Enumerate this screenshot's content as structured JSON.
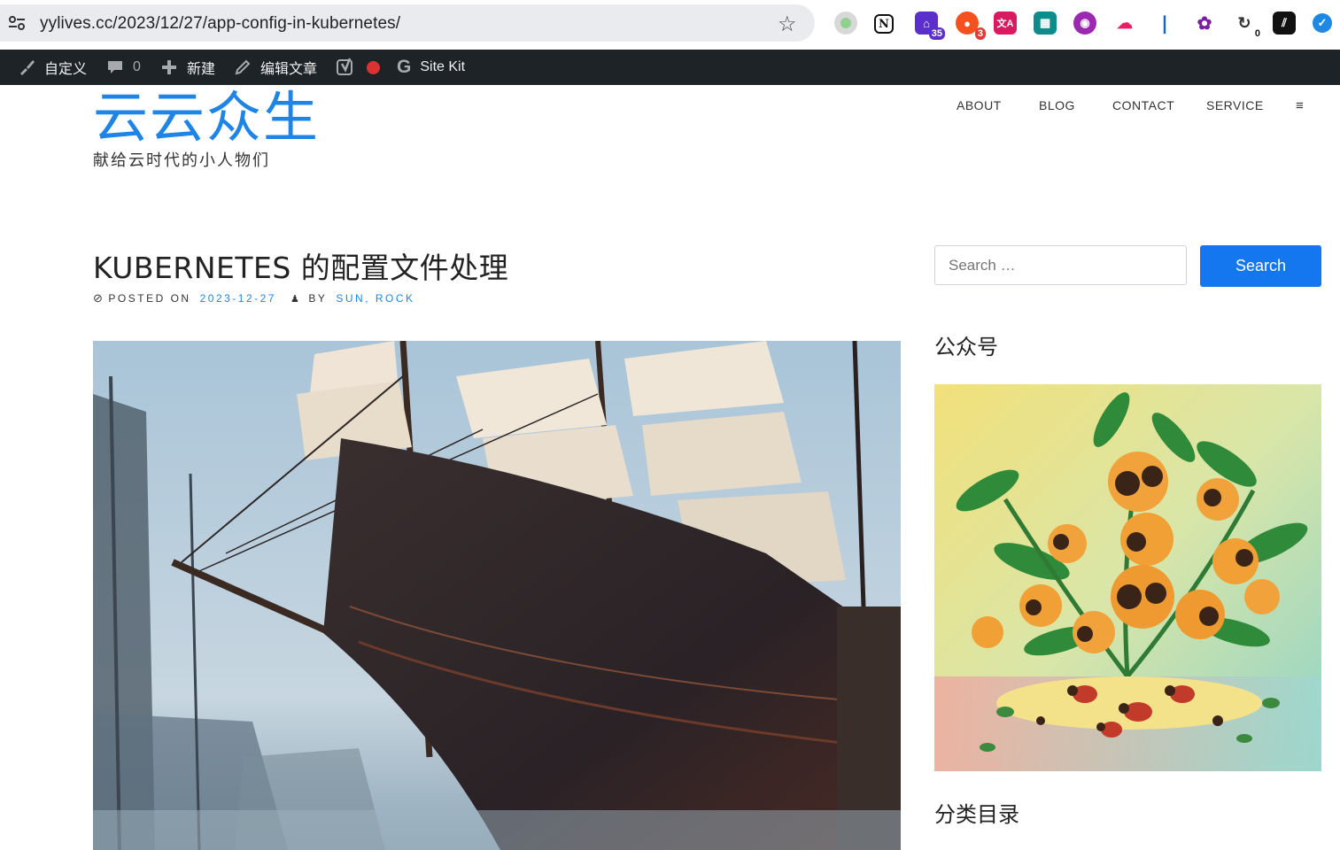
{
  "browser": {
    "url": "yylives.cc/2023/12/27/app-config-in-kubernetes/",
    "extensions": [
      {
        "name": "extension-gray-dot-icon",
        "badge": ""
      },
      {
        "name": "notion-icon",
        "badge": ""
      },
      {
        "name": "extension-house-icon",
        "badge": "35"
      },
      {
        "name": "extension-red-icon",
        "badge": "3"
      },
      {
        "name": "translate-icon",
        "badge": ""
      },
      {
        "name": "extension-grid-icon",
        "badge": ""
      },
      {
        "name": "extension-purple-icon",
        "badge": ""
      },
      {
        "name": "extension-cloud-icon",
        "badge": ""
      },
      {
        "name": "extension-blue-shape-icon",
        "badge": ""
      },
      {
        "name": "openai-icon",
        "badge": ""
      },
      {
        "name": "extension-refresh-icon",
        "badge": "0"
      },
      {
        "name": "extension-dark-icon",
        "badge": ""
      },
      {
        "name": "extension-blue-circle-icon",
        "badge": ""
      }
    ]
  },
  "adminbar": {
    "customize": "自定义",
    "comments_count": "0",
    "new": "新建",
    "edit": "编辑文章",
    "sitekit": "Site Kit"
  },
  "site": {
    "title": "云云众生",
    "description": "献给云时代的小人物们"
  },
  "nav": {
    "items": [
      "ABOUT",
      "BLOG",
      "CONTACT",
      "SERVICE"
    ],
    "menu_icon": "≡"
  },
  "post": {
    "title": "KUBERNETES 的配置文件处理",
    "posted_on_label": "POSTED ON",
    "date": "2023-12-27",
    "by_label": "BY",
    "author": "SUN, ROCK"
  },
  "sidebar": {
    "search_placeholder": "Search …",
    "search_button": "Search",
    "widget1_title": "公众号",
    "widget2_title": "分类目录"
  },
  "colors": {
    "accent": "#1e85e6",
    "button": "#1477f0",
    "adminbar": "#1d2327"
  }
}
